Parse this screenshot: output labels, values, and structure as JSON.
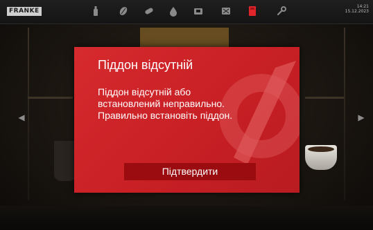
{
  "brand": {
    "logo_text": "FRANKE"
  },
  "status": {
    "time": "14:21",
    "date": "15.12.2023"
  },
  "toolbar": {
    "icons": [
      {
        "name": "bottle-icon",
        "color": "#8a8a8a"
      },
      {
        "name": "bean-icon",
        "color": "#8a8a8a"
      },
      {
        "name": "cleaning-tablet-icon",
        "color": "#8a8a8a"
      },
      {
        "name": "water-drop-icon",
        "color": "#8a8a8a"
      },
      {
        "name": "brew-unit-icon",
        "color": "#8a8a8a"
      },
      {
        "name": "milk-container-icon",
        "color": "#8a8a8a"
      },
      {
        "name": "drip-tray-icon",
        "color": "#e0262b",
        "active": true
      },
      {
        "name": "wrench-icon",
        "color": "#8a8a8a"
      }
    ]
  },
  "navigation": {
    "prev_glyph": "◀",
    "next_glyph": "▶"
  },
  "dialog": {
    "title": "Піддон відсутній",
    "message_lines": [
      "Піддон відсутній або",
      "встановлений неправильно.",
      "Правильно встановіть піддон."
    ],
    "confirm_label": "Підтвердити"
  },
  "colors": {
    "dialog_background": "#d02428",
    "confirm_button": "#9b0c10",
    "alert_accent": "#e0262b"
  }
}
